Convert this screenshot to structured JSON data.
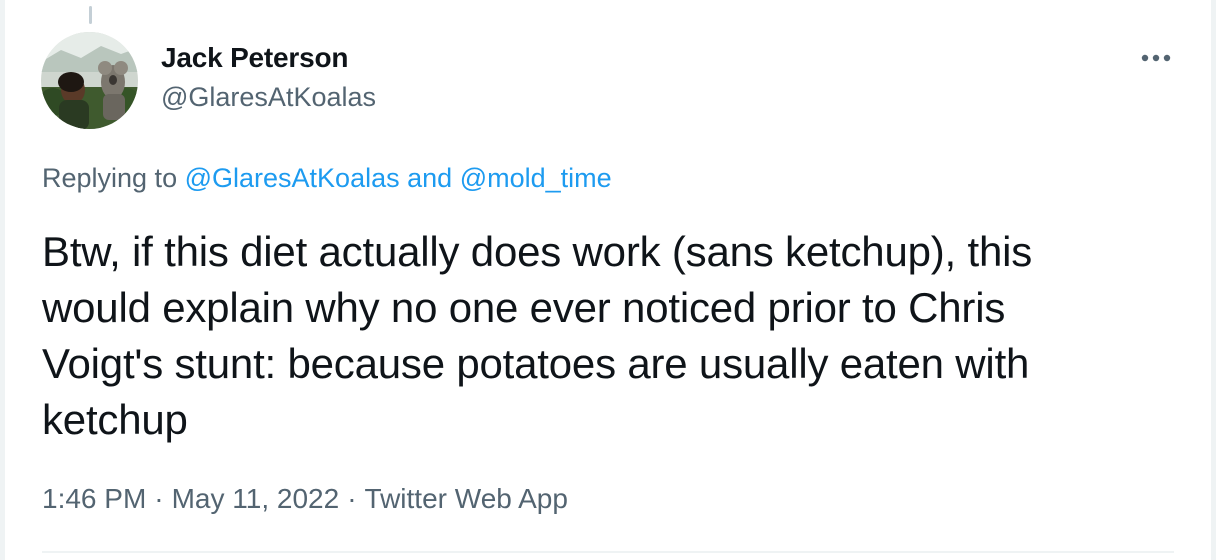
{
  "author": {
    "display_name": "Jack Peterson",
    "handle": "@GlaresAtKoalas",
    "avatar_icon": "profile-photo-with-koala"
  },
  "more_icon": "more-horizontal-icon",
  "reply_context": {
    "prefix": "Replying to",
    "mention_1": "@GlaresAtKoalas",
    "joiner": "and",
    "mention_2": "@mold_time"
  },
  "tweet_lines": [
    "Btw, if this diet actually does work (sans ketchup), this",
    "would explain why no one ever noticed prior to Chris",
    "Voigt's stunt: because potatoes are usually eaten with",
    "ketchup"
  ],
  "meta": {
    "time": "1:46 PM",
    "separator": "·",
    "date": "May 11, 2022",
    "source": "Twitter Web App"
  },
  "colors": {
    "text_primary": "#0f1419",
    "text_secondary": "#536471",
    "link": "#1d9bf0",
    "border": "#eff3f4"
  }
}
